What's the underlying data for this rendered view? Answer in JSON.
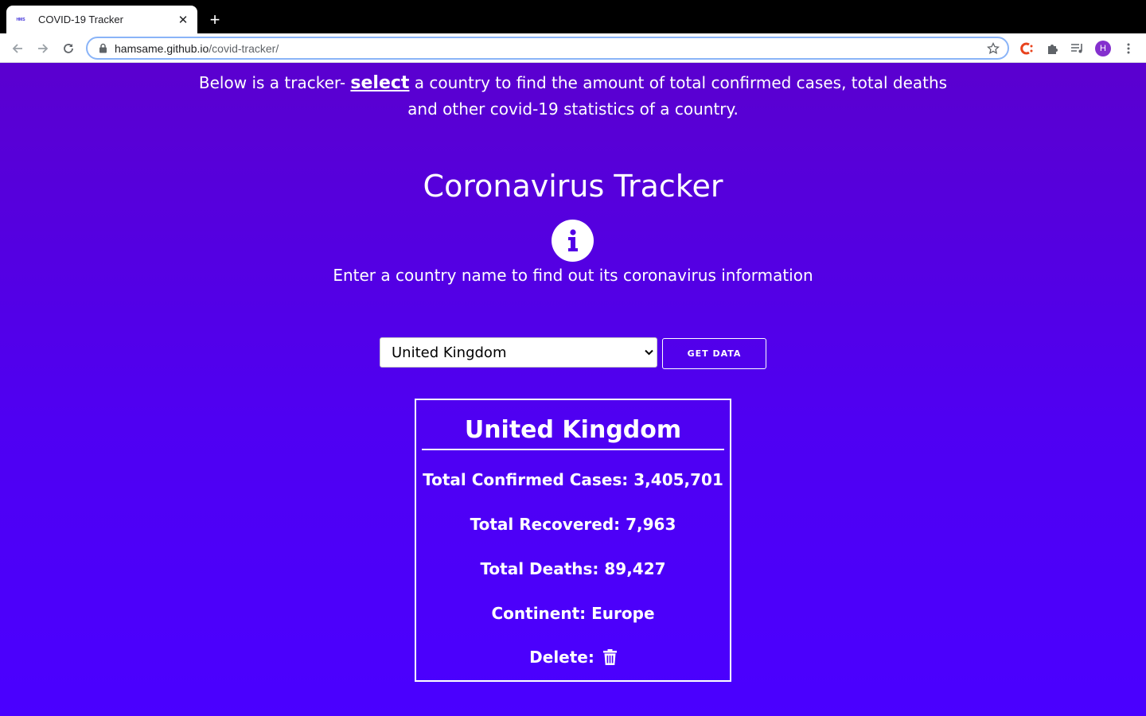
{
  "browser": {
    "tab_title": "COVID-19 Tracker",
    "favicon_text": "HMS",
    "url_host": "hamsame.github.io",
    "url_path": "/covid-tracker/",
    "avatar_letter": "H"
  },
  "intro": {
    "before": "Below is a tracker- ",
    "link": "select",
    "after": " a country to find the amount of total confirmed cases, total deaths and other covid-19 statistics of a country."
  },
  "title": "Coronavirus Tracker",
  "subtitle": "Enter a country name to find out its coronavirus information",
  "form": {
    "selected_country": "United Kingdom",
    "button_label": "GET DATA"
  },
  "card": {
    "country": "United Kingdom",
    "confirmed": "Total Confirmed Cases: 3,405,701",
    "recovered": "Total Recovered: 7,963",
    "deaths": "Total Deaths: 89,427",
    "continent": "Continent: Europe",
    "delete_label": "Delete:"
  },
  "colors": {
    "bg_top": "#5a00cf",
    "bg_bottom": "#4a00ff",
    "text": "#ffffff"
  }
}
